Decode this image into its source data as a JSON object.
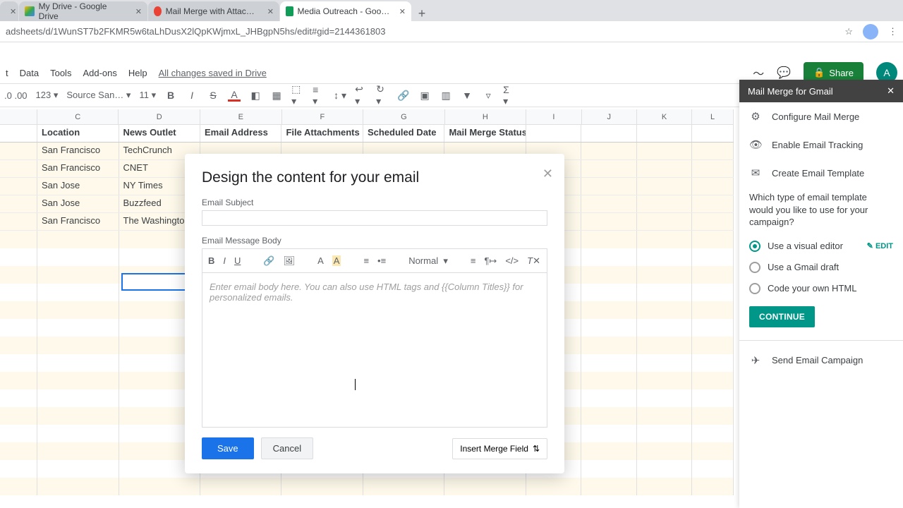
{
  "browser": {
    "tabs": [
      {
        "title": ""
      },
      {
        "title": "My Drive - Google Drive"
      },
      {
        "title": "Mail Merge with Attachments - G"
      },
      {
        "title": "Media Outreach - Google Sheets"
      }
    ],
    "url": "adsheets/d/1WunST7b2FKMR5w6taLhDusX2lQpKWjmxL_JHBgpN5hs/edit#gid=2144361803"
  },
  "menu": {
    "items": [
      "t",
      "Data",
      "Tools",
      "Add-ons",
      "Help"
    ],
    "saved": "All changes saved in Drive",
    "share": "Share",
    "account_initial": "A"
  },
  "toolbar": {
    "decimals": ".0  .00",
    "zoom": "123",
    "font": "Source San…",
    "size": "11"
  },
  "columns": {
    "letters": [
      "",
      "C",
      "D",
      "E",
      "F",
      "G",
      "H",
      "I",
      "J",
      "K",
      "L"
    ],
    "headers": [
      "",
      "Location",
      "News Outlet",
      "Email Address",
      "File Attachments",
      "Scheduled Date",
      "Mail Merge Status",
      "",
      "",
      "",
      ""
    ]
  },
  "rows": [
    {
      "location": "San Francisco",
      "outlet": "TechCrunch"
    },
    {
      "location": "San Francisco",
      "outlet": "CNET"
    },
    {
      "location": "San Jose",
      "outlet": "NY Times"
    },
    {
      "location": "San Jose",
      "outlet": "Buzzfeed"
    },
    {
      "location": "San Francisco",
      "outlet": "The Washington Po"
    }
  ],
  "modal": {
    "title": "Design the content for your email",
    "subject_label": "Email Subject",
    "body_label": "Email Message Body",
    "placeholder": "Enter email body here. You can also use HTML tags and {{Column Titles}} for personalized emails.",
    "format_select": "Normal",
    "save": "Save",
    "cancel": "Cancel",
    "merge_field": "Insert Merge Field"
  },
  "side": {
    "title": "Mail Merge for Gmail",
    "items": {
      "configure": "Configure Mail Merge",
      "tracking": "Enable Email Tracking",
      "template": "Create Email Template"
    },
    "question": "Which type of email template would you like to use for your campaign?",
    "options": {
      "visual": "Use a visual editor",
      "draft": "Use a Gmail draft",
      "html": "Code your own HTML"
    },
    "edit": "EDIT",
    "continue": "CONTINUE",
    "send": "Send Email Campaign"
  }
}
